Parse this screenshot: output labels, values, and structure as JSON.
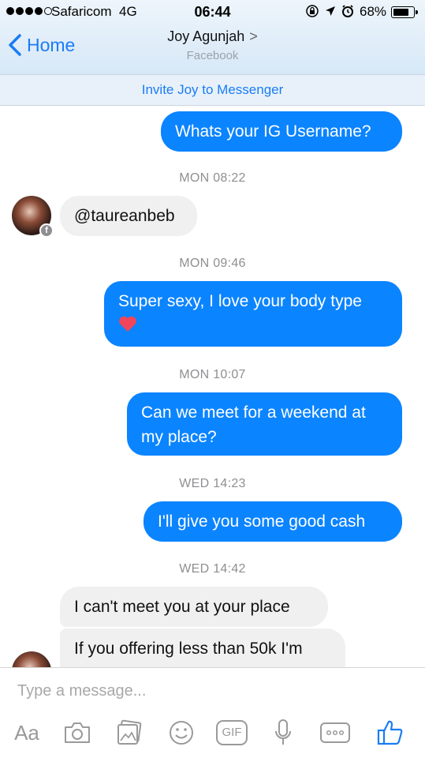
{
  "status_bar": {
    "carrier": "Safaricom",
    "network": "4G",
    "time": "06:44",
    "battery": "68%"
  },
  "header": {
    "back_label": "Home",
    "contact_name": "Joy Agunjah",
    "contact_chevron": ">",
    "contact_subtitle": "Facebook"
  },
  "invite_banner": "Invite Joy to Messenger",
  "messages": [
    {
      "side": "out",
      "text": "Whats your IG Username?"
    },
    {
      "timestamp": "MON 08:22"
    },
    {
      "side": "in",
      "text": "@taureanbeb"
    },
    {
      "timestamp": "MON 09:46"
    },
    {
      "side": "out",
      "text": "Super sexy, I love your body type",
      "emoji": "heart"
    },
    {
      "timestamp": "MON 10:07"
    },
    {
      "side": "out",
      "text": "Can we meet for a weekend at my place?"
    },
    {
      "timestamp": "WED 14:23"
    },
    {
      "side": "out",
      "text": "I'll give you some good cash"
    },
    {
      "timestamp": "WED 14:42"
    },
    {
      "side": "in",
      "text": "I can't meet you at your place"
    },
    {
      "side": "in",
      "text": "If you offering less than 50k I'm"
    }
  ],
  "composer": {
    "placeholder": "Type a message...",
    "toolbar": {
      "text_label": "Aa",
      "gif_label": "GIF",
      "icons": [
        "text-format-icon",
        "camera-icon",
        "gallery-icon",
        "emoji-icon",
        "gif-icon",
        "microphone-icon",
        "more-icon",
        "like-icon"
      ]
    }
  },
  "colors": {
    "accent": "#1a7cf4",
    "outgoing_bubble": "#0b84ff",
    "incoming_bubble": "#f0f0f0",
    "heart": "#f0455a"
  }
}
